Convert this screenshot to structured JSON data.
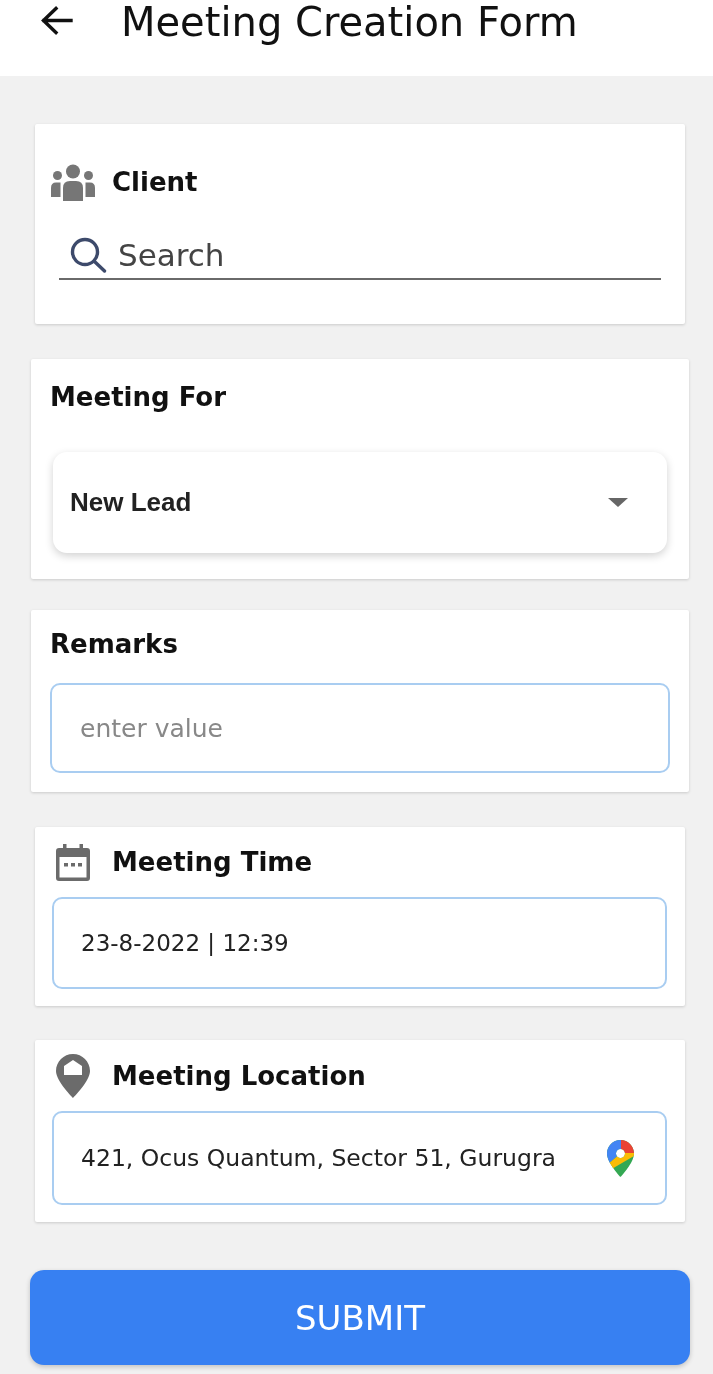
{
  "header": {
    "title": "Meeting Creation Form"
  },
  "sections": [
    {
      "kind": "search",
      "label": "Client",
      "placeholder": "Search"
    },
    {
      "kind": "dropdown",
      "label": "Meeting For",
      "value": "New Lead"
    },
    {
      "kind": "text",
      "label": "Remarks",
      "placeholder": "enter value"
    },
    {
      "kind": "datetime",
      "label": "Meeting Time",
      "value": "23-8-2022 | 12:39"
    },
    {
      "kind": "location",
      "label": "Meeting Location",
      "value": "421, Ocus Quantum, Sector 51, Gurugra"
    }
  ],
  "submit_button": {
    "label": "SUBMIT"
  }
}
